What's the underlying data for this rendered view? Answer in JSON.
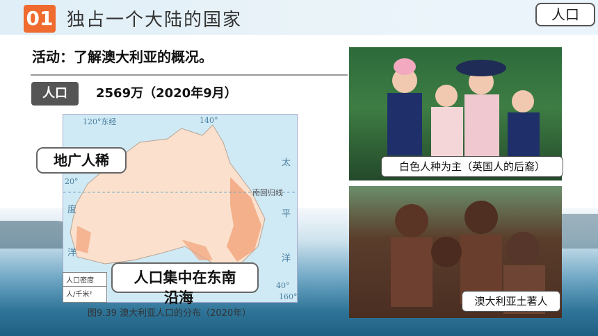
{
  "header": {
    "section_number": "01",
    "title": "独占一个大陆的国家",
    "top_button": "人口"
  },
  "activity": {
    "text": "活动：了解澳大利亚的概况。"
  },
  "population": {
    "tag": "人口",
    "value": "2569万（2020年9月）"
  },
  "map": {
    "caption": "图9.39   澳大利亚人口的分布（2020年）",
    "labels": {
      "lon120": "120°东经",
      "lon140": "140°",
      "lon160": "160°",
      "lat20": "20°",
      "lat40": "40°",
      "tropic": "南回归线",
      "pacific1": "太",
      "pacific2": "平",
      "pacific3": "洋",
      "indian1": "度",
      "indian2": "洋"
    },
    "legend": {
      "title": "人口密度",
      "unit": "人/千米²"
    }
  },
  "callouts": {
    "sparse": "地广人稀",
    "dense_line1": "人口集中在东南",
    "dense_line2": "沿海"
  },
  "photos": {
    "caption1": "白色人种为主（英国人的后裔）",
    "caption2": "澳大利亚土著人"
  }
}
